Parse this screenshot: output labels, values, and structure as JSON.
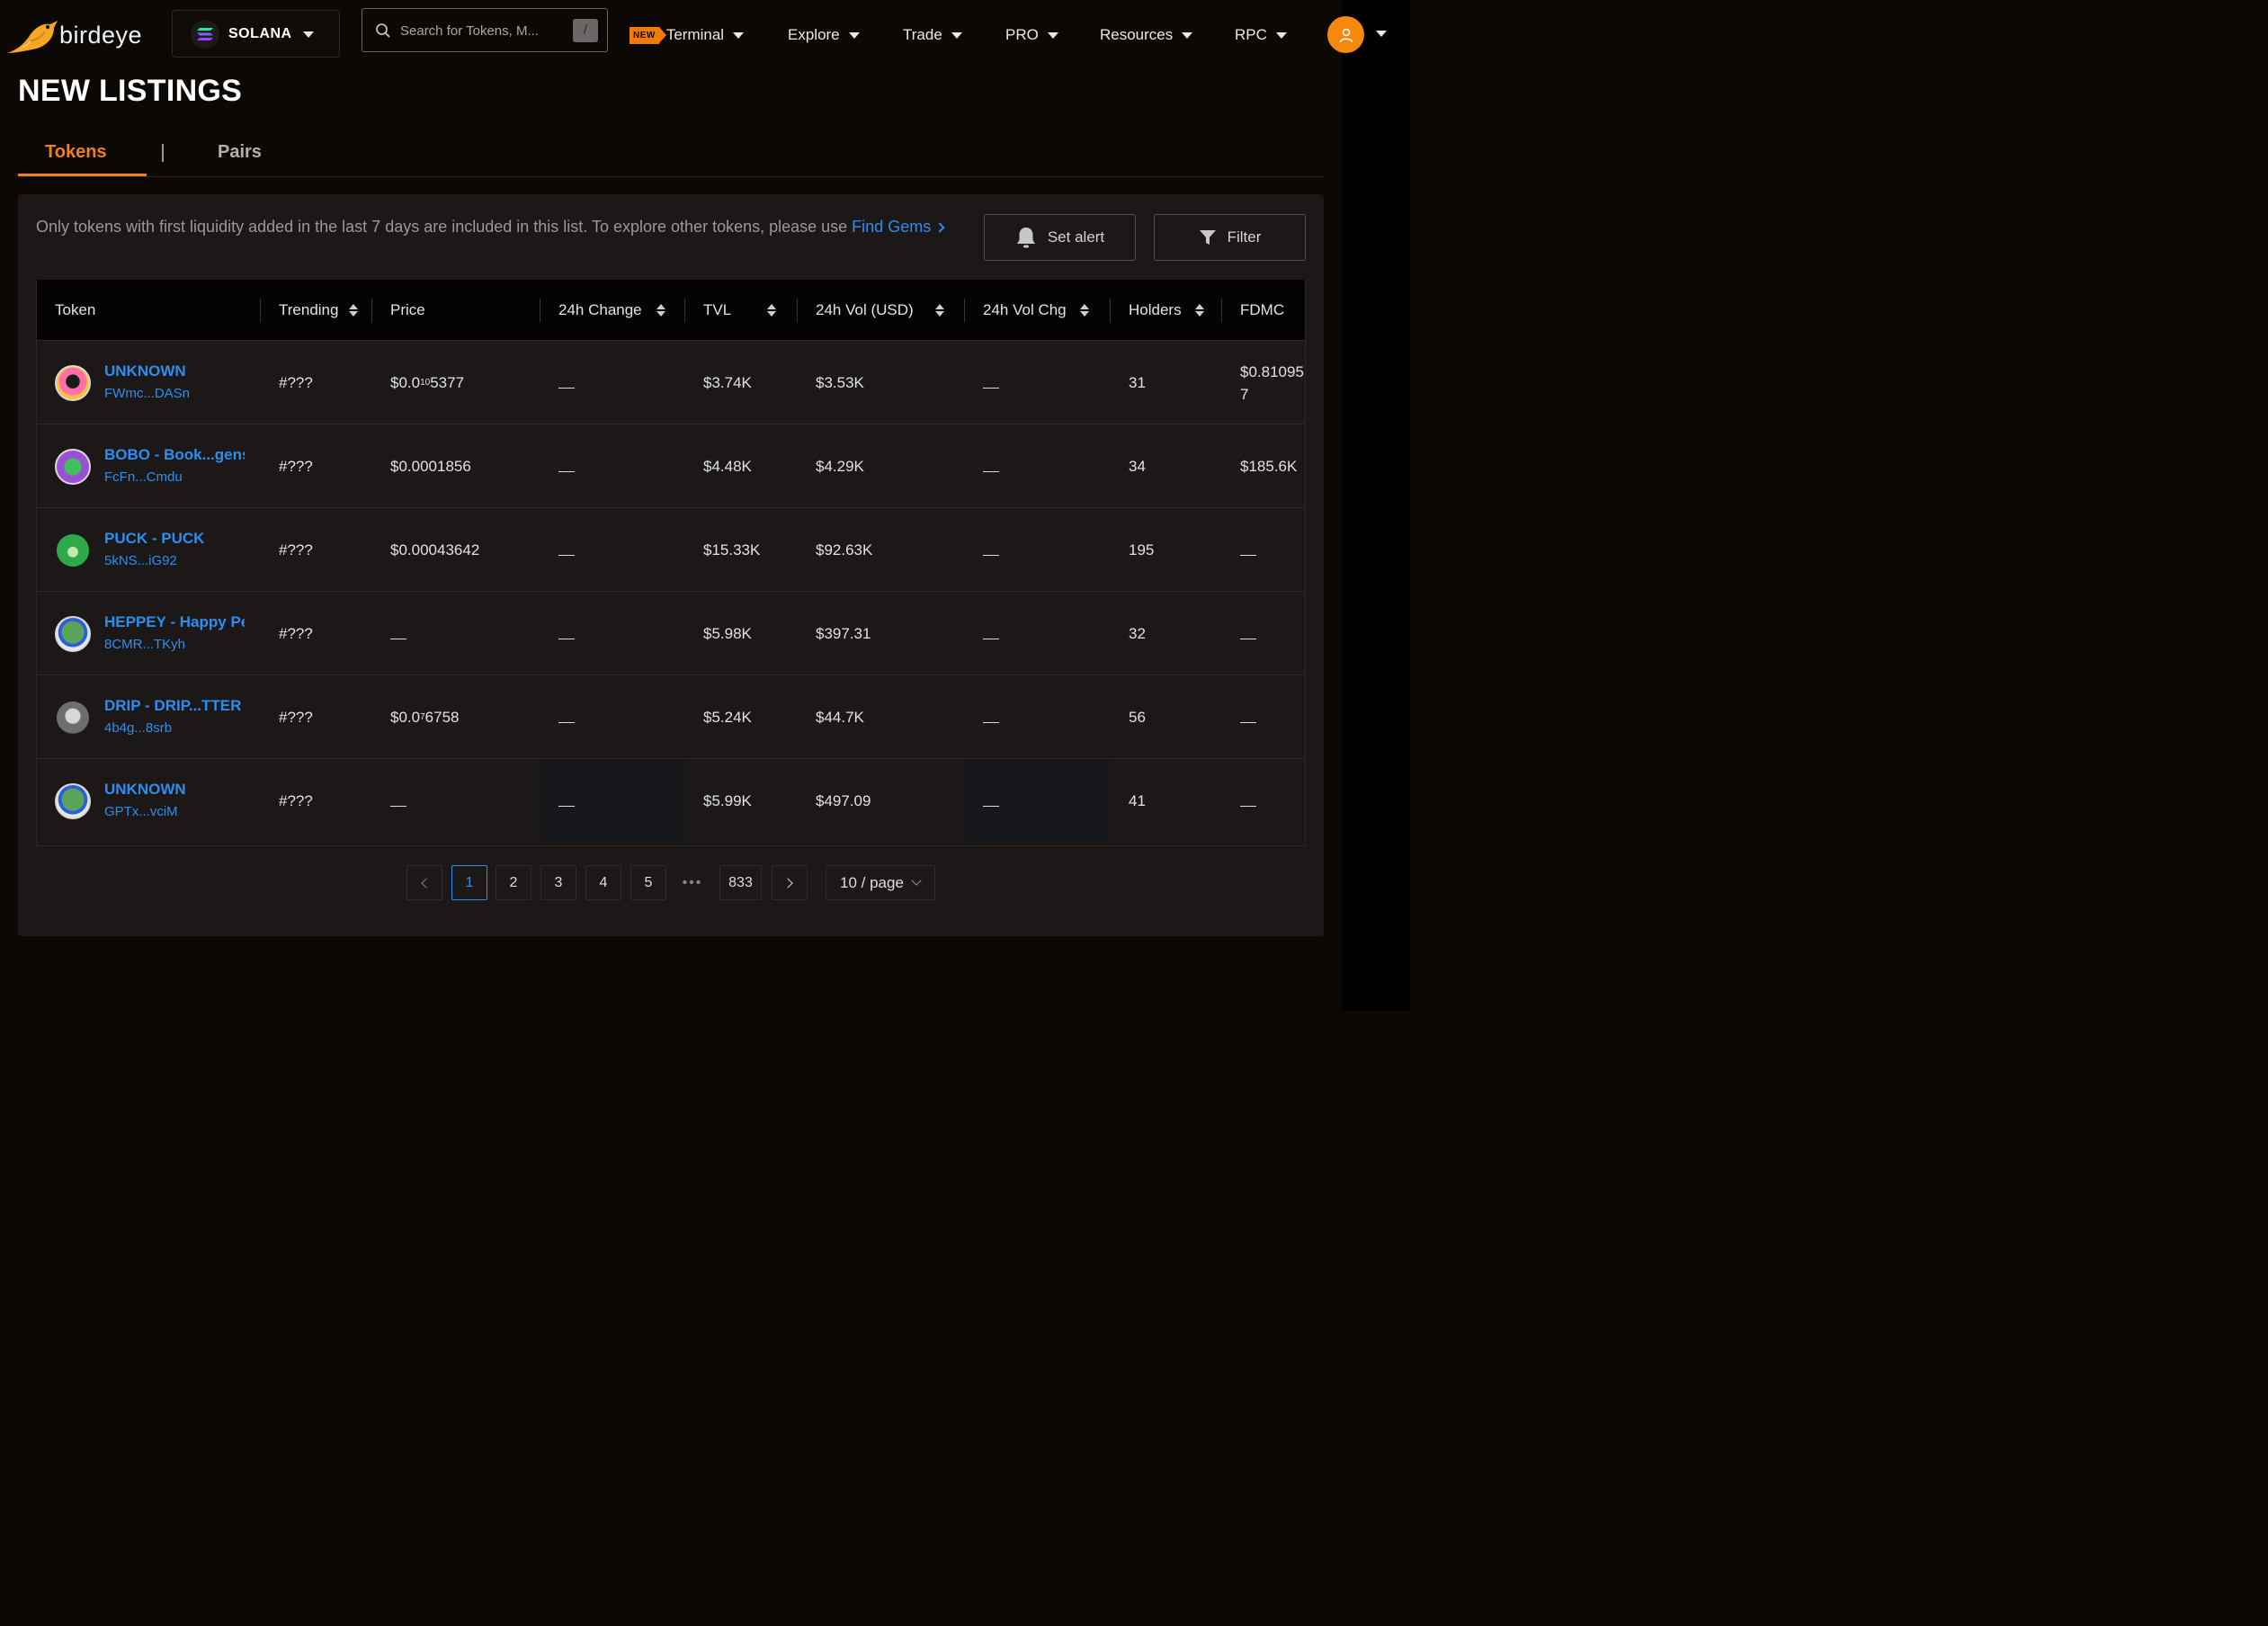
{
  "header": {
    "logo_text": "birdeye",
    "chain": "SOLANA",
    "search_placeholder": "Search for Tokens, M...",
    "search_shortcut": "/",
    "nav": [
      {
        "label": "Terminal",
        "badge": "NEW"
      },
      {
        "label": "Explore"
      },
      {
        "label": "Trade"
      },
      {
        "label": "PRO"
      },
      {
        "label": "Resources"
      },
      {
        "label": "RPC"
      }
    ]
  },
  "page": {
    "title": "NEW LISTINGS",
    "tabs": [
      "Tokens",
      "Pairs"
    ],
    "active_tab": "Tokens",
    "notice": "Only tokens with first liquidity added in the last 7 days are included in this list. To explore other tokens, please use ",
    "notice_link": "Find Gems",
    "buttons": {
      "alert": "Set alert",
      "filter": "Filter"
    }
  },
  "table": {
    "columns": [
      "Token",
      "Trending",
      "Price",
      "24h Change",
      "TVL",
      "24h Vol (USD)",
      "24h Vol Chg",
      "Holders",
      "FDMC"
    ],
    "rows": [
      {
        "name": "UNKNOWN",
        "address": "FWmc...DASn",
        "trending": "#???",
        "price_main": "$0.0",
        "price_sub": "10",
        "price_tail": "5377",
        "change": "",
        "tvl": "$3.74K",
        "vol": "$3.53K",
        "vol_chg": "",
        "holders": "31",
        "fdmc": "$0.81095\n7"
      },
      {
        "name": "BOBO - Book...gens",
        "address": "FcFn...Cmdu",
        "trending": "#???",
        "price_main": "$0.0001856",
        "price_sub": "",
        "price_tail": "",
        "change": "",
        "tvl": "$4.48K",
        "vol": "$4.29K",
        "vol_chg": "",
        "holders": "34",
        "fdmc": "$185.6K"
      },
      {
        "name": "PUCK - PUCK",
        "address": "5kNS...iG92",
        "trending": "#???",
        "price_main": "$0.00043642",
        "price_sub": "",
        "price_tail": "",
        "change": "",
        "tvl": "$15.33K",
        "vol": "$92.63K",
        "vol_chg": "",
        "holders": "195",
        "fdmc": ""
      },
      {
        "name": "HEPPEY - Happy Pe",
        "address": "8CMR...TKyh",
        "trending": "#???",
        "price_main": "",
        "price_sub": "",
        "price_tail": "",
        "change": "",
        "tvl": "$5.98K",
        "vol": "$397.31",
        "vol_chg": "",
        "holders": "32",
        "fdmc": ""
      },
      {
        "name": "DRIP - DRIP...TTER",
        "address": "4b4g...8srb",
        "trending": "#???",
        "price_main": "$0.0",
        "price_sub": "7",
        "price_tail": "6758",
        "change": "",
        "tvl": "$5.24K",
        "vol": "$44.7K",
        "vol_chg": "",
        "holders": "56",
        "fdmc": ""
      },
      {
        "name": "UNKNOWN",
        "address": "GPTx...vciM",
        "trending": "#???",
        "price_main": "",
        "price_sub": "",
        "price_tail": "",
        "change": "",
        "tvl": "$5.99K",
        "vol": "$497.09",
        "vol_chg": "",
        "holders": "41",
        "fdmc": ""
      }
    ]
  },
  "pagination": {
    "pages": [
      "1",
      "2",
      "3",
      "4",
      "5"
    ],
    "ellipsis": "•••",
    "last_page": "833",
    "current": "1",
    "page_size": "10 / page"
  },
  "colors": {
    "accent": "#f2801d",
    "link": "#2b8ff2",
    "background": "#0c0806",
    "panel": "#1b1817"
  }
}
